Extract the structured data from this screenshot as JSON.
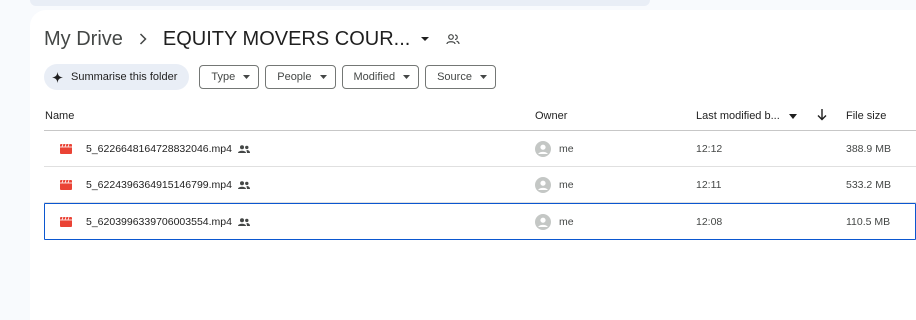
{
  "breadcrumb": {
    "root": "My Drive",
    "current": "EQUITY MOVERS COUR..."
  },
  "chips": {
    "summarise_label": "Summarise this folder",
    "filters": [
      "Type",
      "People",
      "Modified",
      "Source"
    ]
  },
  "table": {
    "headers": {
      "name": "Name",
      "owner": "Owner",
      "modified": "Last modified b...",
      "size": "File size"
    },
    "rows": [
      {
        "name": "5_6226648164728832046.mp4",
        "owner": "me",
        "modified": "12:12",
        "size": "388.9 MB"
      },
      {
        "name": "5_6224396364915146799.mp4",
        "owner": "me",
        "modified": "12:11",
        "size": "533.2 MB"
      },
      {
        "name": "5_6203996339706003554.mp4",
        "owner": "me",
        "modified": "12:08",
        "size": "110.5 MB"
      }
    ]
  },
  "colors": {
    "file_icon": "#ea4335",
    "selection": "#0b57d0",
    "chip_ai_bg": "#e9eef6"
  }
}
